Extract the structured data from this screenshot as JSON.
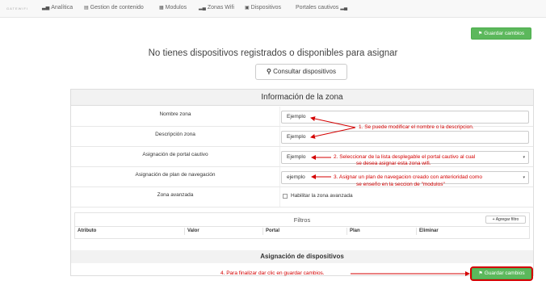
{
  "navbar": {
    "brand": "GATEWIFI",
    "items": [
      {
        "label": "Analítica",
        "icon": "bar-chart-icon",
        "glyph": "▃▅"
      },
      {
        "label": "Gestion de contenido",
        "icon": "book-icon",
        "glyph": "▤"
      },
      {
        "label": "Modulos",
        "icon": "grid-icon",
        "glyph": "▦"
      },
      {
        "label": "Zonas Wifi",
        "icon": "signal-icon",
        "glyph": "▂▄"
      },
      {
        "label": "Dispositivos",
        "icon": "device-icon",
        "glyph": "▣"
      },
      {
        "label": "Portales cautivos",
        "icon": "signal-icon",
        "glyph": "▂▄"
      }
    ]
  },
  "actions": {
    "save_label": "Guardar cambios",
    "save_icon": "⚑"
  },
  "main": {
    "no_devices_msg": "No tienes dispositivos registrados o disponibles para asignar",
    "consult_label": "Consultar dispositivos",
    "search_glyph": "⚲"
  },
  "zone_info": {
    "title": "Información de la zona",
    "rows": [
      {
        "label": "Nombre zona",
        "value": "Ejemplo"
      },
      {
        "label": "Descripción zona",
        "value": "Ejemplo"
      },
      {
        "label": "Asignación de portal cautivo",
        "value": "Ejemplo"
      },
      {
        "label": "Asignación de plan de navegación",
        "value": "ejemplo"
      },
      {
        "label": "Zona avanzada",
        "checkbox_label": "Habilitar la zona avanzada"
      }
    ],
    "caret": "▾"
  },
  "filters": {
    "title": "Filtros",
    "add_label": "+ Agregar filtro",
    "columns": [
      "Atributo",
      "Valor",
      "Portal",
      "Plan",
      "Eliminar"
    ]
  },
  "devices_section": {
    "title": "Asignación de dispositivos"
  },
  "annotations": {
    "a1": "1. Se puede modificar el nombre o la descripcion.",
    "a2_l1": "2. Seleccionar de la lista desplegable el portal cautivo al cual",
    "a2_l2": "se desea asignar esta zona wifi.",
    "a3_l1": "3. Asignar un plan de navegacion creado con anterioridad como",
    "a3_l2": "se enseño en la seccion de \"modulos\"",
    "a4": "4. Para finalizar dar clic en guardar cambios.",
    "color": "#d40000"
  }
}
